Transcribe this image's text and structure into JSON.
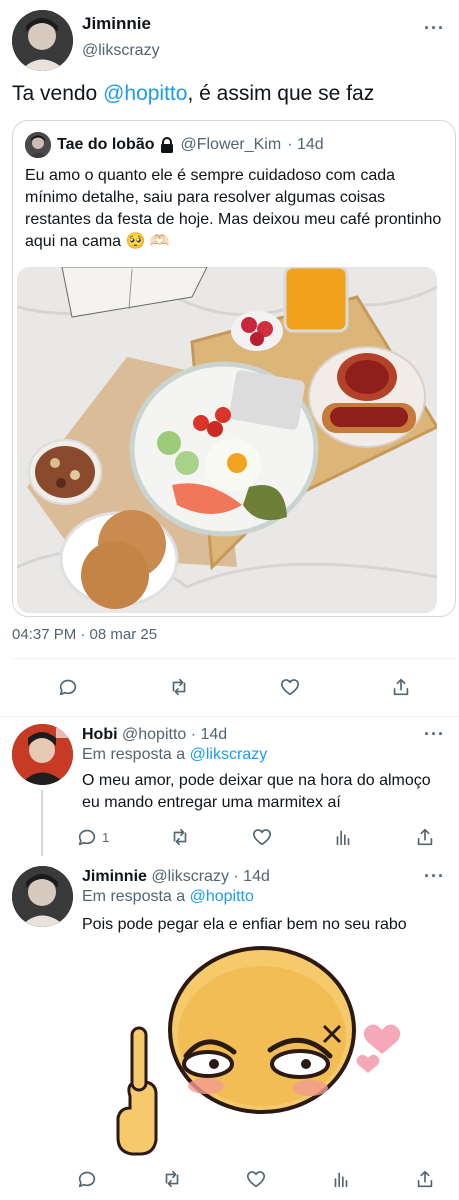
{
  "tweet": {
    "name": "Jiminnie",
    "handle": "@likscrazy",
    "text_before": "Ta vendo ",
    "mention": "@hopitto",
    "text_after": ", é assim que se faz",
    "timestamp": "04:37 PM · 08 mar 25"
  },
  "quote": {
    "name": "Tae do lobão",
    "locked_icon": "lock-icon",
    "handle": "@Flower_Kim",
    "age": "· 14d",
    "text": "Eu amo o quanto ele é sempre cuidadoso com cada mínimo detalhe, saiu para resolver algumas coisas restantes da festa de hoje. Mas deixou meu café prontinho aqui na cama 🥺 🫶🏻",
    "image_icon": "breakfast-tray-photo"
  },
  "replies": [
    {
      "name": "Hobi",
      "handle": "@hopitto",
      "age": "· 14d",
      "in_reply_label": "Em resposta a ",
      "in_reply_to": "@likscrazy",
      "text": "O meu amor, pode deixar que na hora do almoço eu mando entregar uma marmitex aí",
      "reply_count": "1"
    },
    {
      "name": "Jiminnie",
      "handle": "@likscrazy",
      "age": "· 14d",
      "in_reply_label": "Em resposta a ",
      "in_reply_to": "@hopitto",
      "text": "Pois pode pegar ela e enfiar bem no seu rabo",
      "sticker": "angry-cursed-emoji-sticker"
    }
  ],
  "icons": {
    "more": "···",
    "reply": "reply-icon",
    "retweet": "retweet-icon",
    "like": "heart-icon",
    "views": "views-icon",
    "share": "share-icon"
  },
  "colors": {
    "link": "#1d9bf0",
    "muted": "#536471",
    "border": "#cfd9de"
  }
}
